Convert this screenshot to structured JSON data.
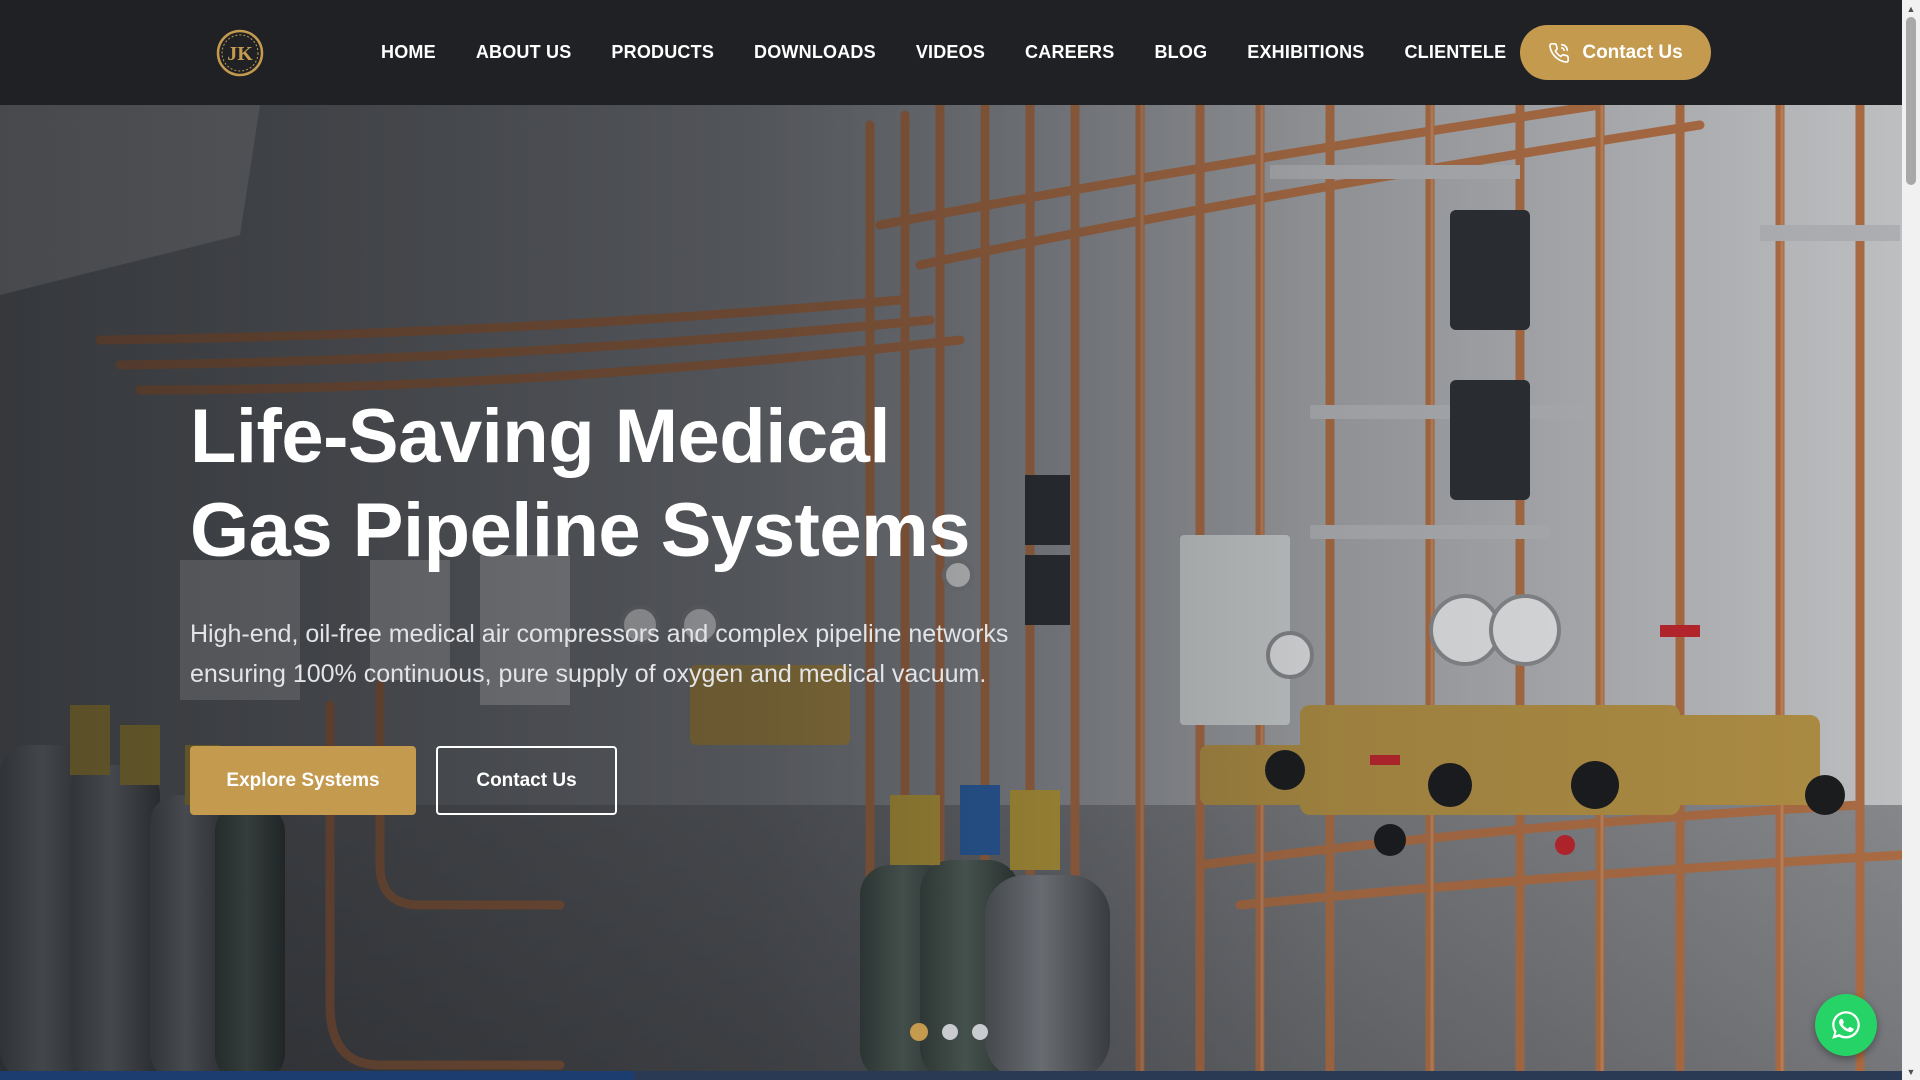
{
  "header": {
    "logo_text": "JK",
    "nav": [
      {
        "label": "HOME"
      },
      {
        "label": "ABOUT US"
      },
      {
        "label": "PRODUCTS"
      },
      {
        "label": "DOWNLOADS"
      },
      {
        "label": "VIDEOS"
      },
      {
        "label": "CAREERS"
      },
      {
        "label": "BLOG"
      },
      {
        "label": "EXHIBITIONS"
      },
      {
        "label": "CLIENTELE"
      }
    ],
    "cta_label": "Contact Us"
  },
  "hero": {
    "title_line1": "Life-Saving Medical",
    "title_line2": "Gas Pipeline Systems",
    "subtitle": "High-end, oil-free medical air compressors and complex pipeline networks ensuring 100% continuous, pure supply of oxygen and medical vacuum.",
    "primary_button": "Explore Systems",
    "secondary_button": "Contact Us",
    "slides": 3,
    "active_slide": 1
  },
  "icons": {
    "logo": "jk-logo-icon",
    "phone": "phone-icon",
    "whatsapp": "whatsapp-icon"
  },
  "colors": {
    "accent": "#c49a4f",
    "header_bg": "#1f2124",
    "whatsapp": "#25d366"
  }
}
